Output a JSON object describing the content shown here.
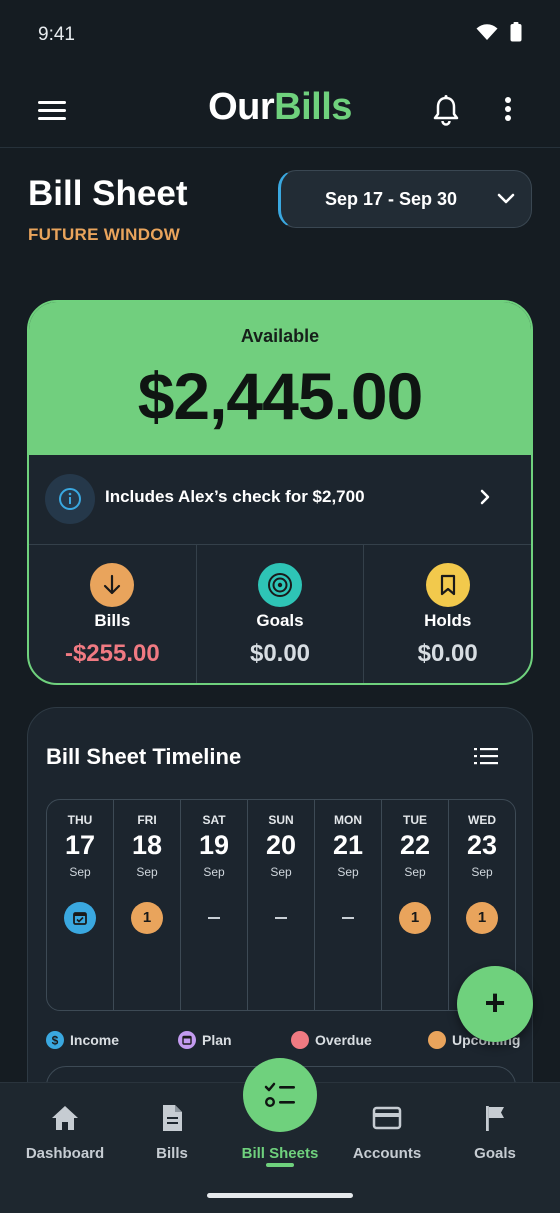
{
  "status_bar": {
    "time": "9:41",
    "icons": [
      "wifi-icon",
      "battery-icon"
    ]
  },
  "app_bar": {
    "logo_part1": "Our",
    "logo_part2": "Bills",
    "brand_color": "#6fd17d"
  },
  "header": {
    "title": "Bill Sheet",
    "subtitle": "FUTURE WINDOW",
    "date_range": "Sep 17 - Sep 30"
  },
  "available_card": {
    "label": "Available",
    "amount": "$2,445.00",
    "info_text": "Includes Alex’s check for $2,700",
    "stats": [
      {
        "label": "Bills",
        "value": "-$255.00",
        "icon": "arrow-down-icon",
        "color": "#e9a45c",
        "value_color": "#f07a82"
      },
      {
        "label": "Goals",
        "value": "$0.00",
        "icon": "target-icon",
        "color": "#2ec4b6",
        "value_color": "#d7dde2"
      },
      {
        "label": "Holds",
        "value": "$0.00",
        "icon": "bookmark-icon",
        "color": "#f2c94c",
        "value_color": "#d7dde2"
      }
    ]
  },
  "timeline": {
    "title": "Bill Sheet Timeline",
    "days": [
      {
        "dow": "THU",
        "num": "17",
        "mon": "Sep",
        "marker": "calendar",
        "marker_label": ""
      },
      {
        "dow": "FRI",
        "num": "18",
        "mon": "Sep",
        "marker": "upcoming",
        "marker_label": "1"
      },
      {
        "dow": "SAT",
        "num": "19",
        "mon": "Sep",
        "marker": "none",
        "marker_label": ""
      },
      {
        "dow": "SUN",
        "num": "20",
        "mon": "Sep",
        "marker": "none",
        "marker_label": ""
      },
      {
        "dow": "MON",
        "num": "21",
        "mon": "Sep",
        "marker": "none",
        "marker_label": ""
      },
      {
        "dow": "TUE",
        "num": "22",
        "mon": "Sep",
        "marker": "upcoming",
        "marker_label": "1"
      },
      {
        "dow": "WED",
        "num": "23",
        "mon": "Sep",
        "marker": "upcoming",
        "marker_label": "1"
      }
    ],
    "legend": [
      {
        "label": "Income",
        "color": "#3aa8e0",
        "icon": "dollar-icon"
      },
      {
        "label": "Plan",
        "color": "#c39bf0",
        "icon": "calendar-icon"
      },
      {
        "label": "Overdue",
        "color": "#f07a82",
        "icon": ""
      },
      {
        "label": "Upcoming",
        "color": "#e9a45c",
        "icon": ""
      }
    ]
  },
  "fab": {
    "label": "+"
  },
  "bottom_nav": {
    "items": [
      {
        "label": "Dashboard",
        "icon": "home-icon"
      },
      {
        "label": "Bills",
        "icon": "document-icon"
      },
      {
        "label": "Bill Sheets",
        "icon": "checklist-icon",
        "active": true
      },
      {
        "label": "Accounts",
        "icon": "card-icon"
      },
      {
        "label": "Goals",
        "icon": "flag-icon"
      }
    ]
  }
}
